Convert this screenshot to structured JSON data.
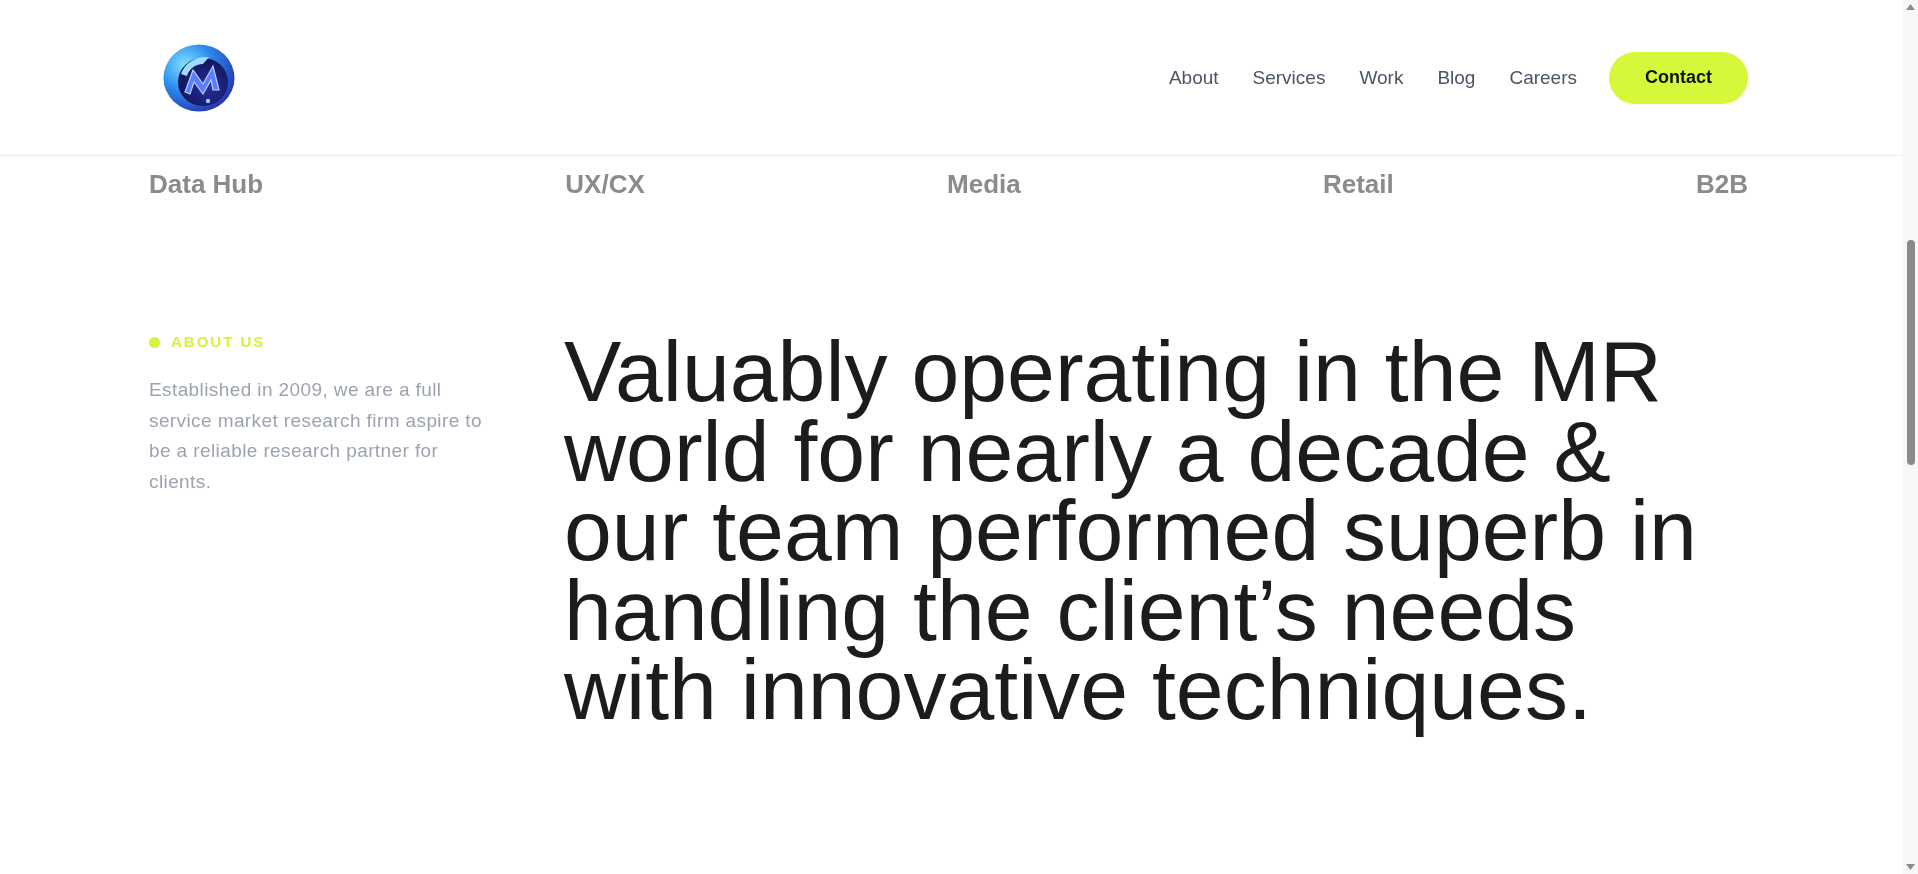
{
  "header": {
    "nav_links": [
      "About",
      "Services",
      "Work",
      "Blog",
      "Careers"
    ],
    "contact_button": "Contact"
  },
  "categories": [
    "Data Hub",
    "UX/CX",
    "Media",
    "Retail",
    "B2B"
  ],
  "about": {
    "label": "ABOUT US",
    "text": "Established in 2009, we are a full service market research firm aspire to be a reliable research partner for clients.",
    "heading": "Valuably operating in the MR world for nearly a decade & our team performed superb in handling the client’s needs with innovative techniques."
  }
}
